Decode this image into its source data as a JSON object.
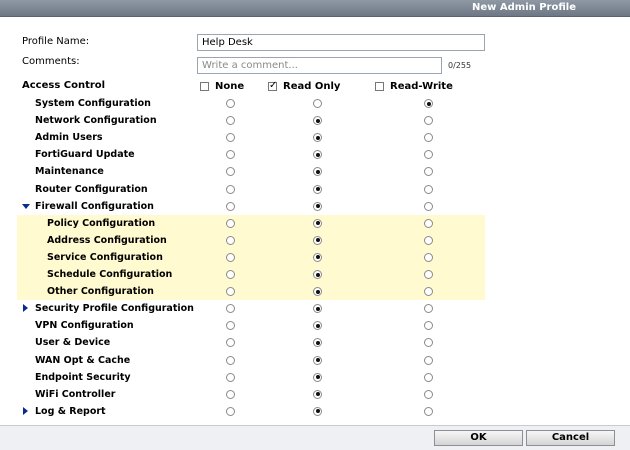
{
  "window": {
    "title": "New Admin Profile"
  },
  "form": {
    "profile_name_label": "Profile Name:",
    "profile_name_value": "Help Desk",
    "comments_label": "Comments:",
    "comments_placeholder": "Write a comment...",
    "comments_counter": "0/255"
  },
  "access": {
    "header": "Access Control",
    "columns": [
      {
        "label": "None",
        "checked": false
      },
      {
        "label": "Read Only",
        "checked": true
      },
      {
        "label": "Read-Write",
        "checked": false
      }
    ],
    "rows": [
      {
        "label": "System Configuration",
        "selected": "read-write",
        "sub": false,
        "expander": null
      },
      {
        "label": "Network Configuration",
        "selected": "read-only",
        "sub": false,
        "expander": null
      },
      {
        "label": "Admin Users",
        "selected": "read-only",
        "sub": false,
        "expander": null
      },
      {
        "label": "FortiGuard Update",
        "selected": "read-only",
        "sub": false,
        "expander": null
      },
      {
        "label": "Maintenance",
        "selected": "read-only",
        "sub": false,
        "expander": null
      },
      {
        "label": "Router Configuration",
        "selected": "read-only",
        "sub": false,
        "expander": null
      },
      {
        "label": "Firewall Configuration",
        "selected": "read-only",
        "sub": false,
        "expander": "expanded"
      },
      {
        "label": "Policy Configuration",
        "selected": "read-only",
        "sub": true,
        "expander": null
      },
      {
        "label": "Address Configuration",
        "selected": "read-only",
        "sub": true,
        "expander": null
      },
      {
        "label": "Service Configuration",
        "selected": "read-only",
        "sub": true,
        "expander": null
      },
      {
        "label": "Schedule Configuration",
        "selected": "read-only",
        "sub": true,
        "expander": null
      },
      {
        "label": "Other Configuration",
        "selected": "read-only",
        "sub": true,
        "expander": null
      },
      {
        "label": "Security Profile Configuration",
        "selected": "read-only",
        "sub": false,
        "expander": "collapsed"
      },
      {
        "label": "VPN Configuration",
        "selected": "read-only",
        "sub": false,
        "expander": null
      },
      {
        "label": "User & Device",
        "selected": "read-only",
        "sub": false,
        "expander": null
      },
      {
        "label": "WAN Opt & Cache",
        "selected": "read-only",
        "sub": false,
        "expander": null
      },
      {
        "label": "Endpoint Security",
        "selected": "read-only",
        "sub": false,
        "expander": null
      },
      {
        "label": "WiFi Controller",
        "selected": "read-only",
        "sub": false,
        "expander": null
      },
      {
        "label": "Log & Report",
        "selected": "read-only",
        "sub": false,
        "expander": "collapsed"
      }
    ]
  },
  "buttons": {
    "ok": "OK",
    "cancel": "Cancel"
  }
}
